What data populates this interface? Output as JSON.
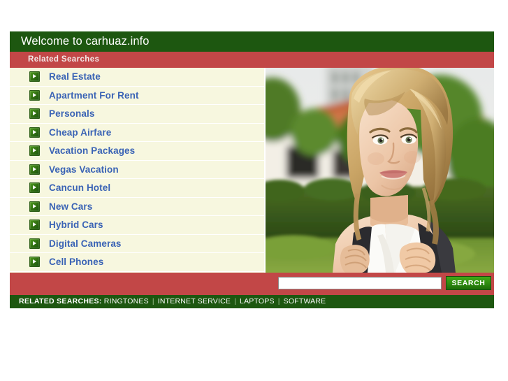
{
  "header": {
    "title": "Welcome to carhuaz.info",
    "sub_title": "Related Searches",
    "title_bg": "#1d5710",
    "sub_bg": "#c24747"
  },
  "links": {
    "icon_name": "arrow-right-icon",
    "items": [
      {
        "label": "Real Estate"
      },
      {
        "label": "Apartment For Rent"
      },
      {
        "label": "Personals"
      },
      {
        "label": "Cheap Airfare"
      },
      {
        "label": "Vacation Packages"
      },
      {
        "label": "Vegas Vacation"
      },
      {
        "label": "Cancun Hotel"
      },
      {
        "label": "New Cars"
      },
      {
        "label": "Hybrid Cars"
      },
      {
        "label": "Digital Cameras"
      },
      {
        "label": "Cell Phones"
      }
    ],
    "link_color": "#3a63b5",
    "panel_bg": "#f7f7df"
  },
  "photo": {
    "description": "smiling blonde young woman with backpack outdoors in front of a house with red tile roof and hedge"
  },
  "search": {
    "value": "",
    "placeholder": "",
    "button_label": "SEARCH",
    "strip_bg": "#c24747",
    "button_color": "#2f8d10"
  },
  "related_bar": {
    "label": "RELATED SEARCHES:",
    "separator": "|",
    "items": [
      {
        "label": "RINGTONES"
      },
      {
        "label": "INTERNET SERVICE"
      },
      {
        "label": "LAPTOPS"
      },
      {
        "label": "SOFTWARE"
      }
    ],
    "bg": "#1d5710"
  }
}
